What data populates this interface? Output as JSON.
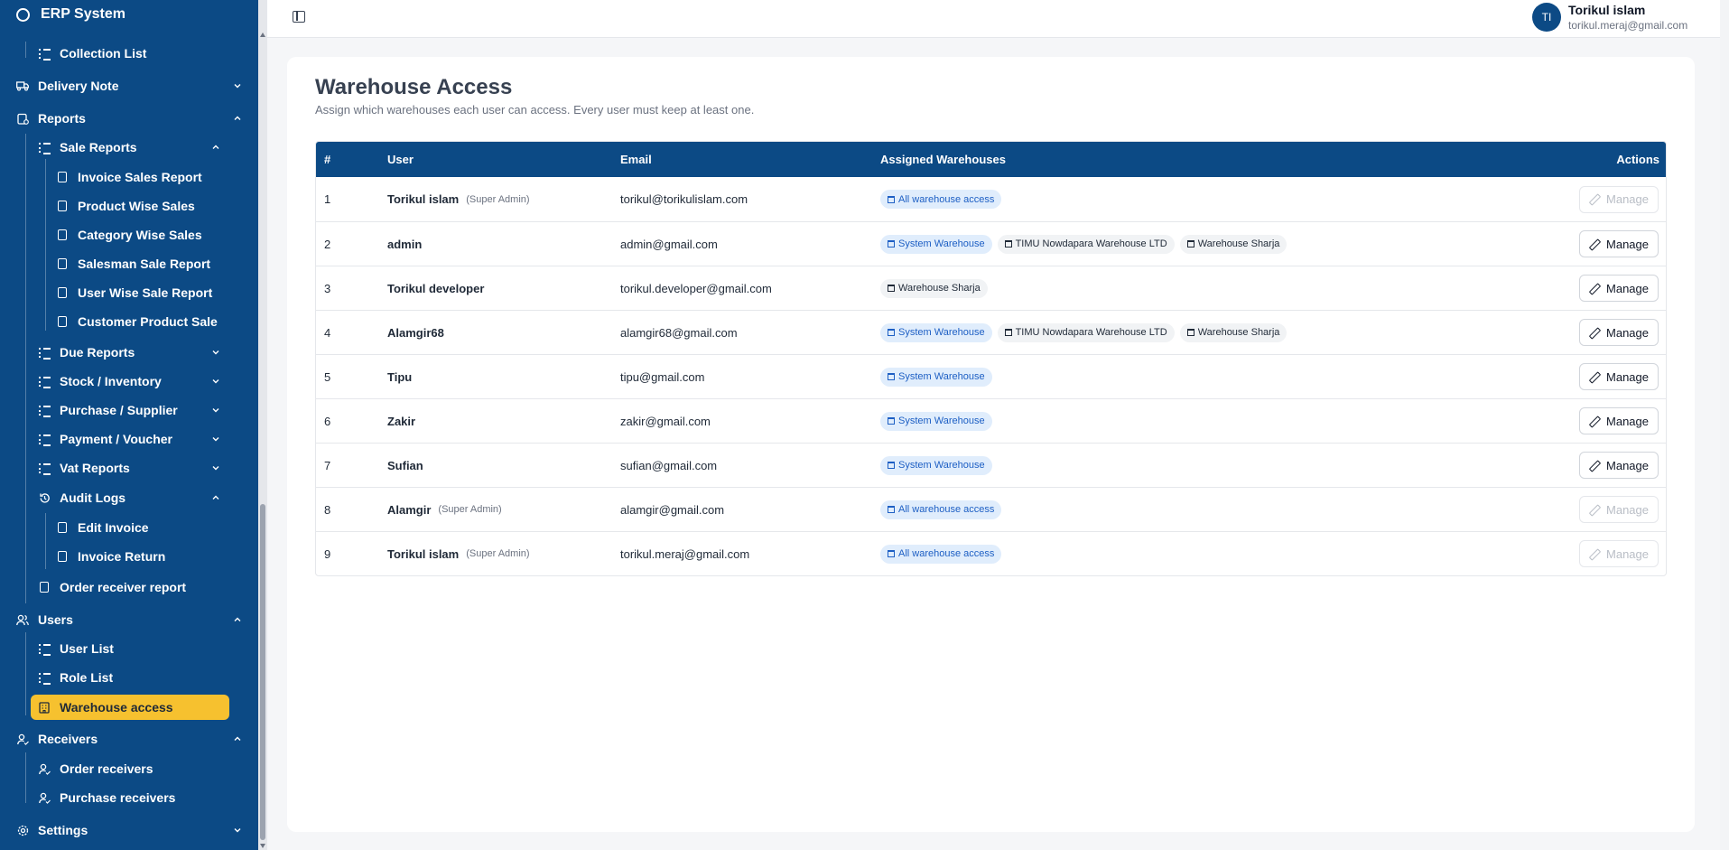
{
  "app": {
    "title": "ERP System"
  },
  "header": {
    "user_name": "Torikul islam",
    "user_email": "torikul.meraj@gmail.com",
    "avatar_initials": "TI"
  },
  "sidebar": {
    "collection_list": "Collection List",
    "delivery_note": "Delivery Note",
    "reports": "Reports",
    "sale_reports": "Sale Reports",
    "sale_items": [
      "Invoice Sales Report",
      "Product Wise Sales",
      "Category Wise Sales",
      "Salesman Sale Report",
      "User Wise Sale Report",
      "Customer Product Sale"
    ],
    "due_reports": "Due Reports",
    "stock_inventory": "Stock / Inventory",
    "purchase_supplier": "Purchase / Supplier",
    "payment_voucher": "Payment / Voucher",
    "vat_reports": "Vat Reports",
    "audit_logs": "Audit Logs",
    "audit_items": [
      "Edit Invoice",
      "Invoice Return"
    ],
    "order_receiver_report": "Order receiver report",
    "users": "Users",
    "user_list": "User List",
    "role_list": "Role List",
    "warehouse_access": "Warehouse access",
    "receivers": "Receivers",
    "order_receivers": "Order receivers",
    "purchase_receivers": "Purchase receivers",
    "settings": "Settings"
  },
  "page": {
    "title": "Warehouse Access",
    "subtitle": "Assign which warehouses each user can access. Every user must keep at least one."
  },
  "table": {
    "headers": {
      "num": "#",
      "user": "User",
      "email": "Email",
      "warehouses": "Assigned Warehouses",
      "actions": "Actions"
    },
    "manage_label": "Manage",
    "rows": [
      {
        "num": "1",
        "name": "Torikul islam",
        "role": "(Super Admin)",
        "email": "torikul@torikulislam.com",
        "chips": [
          {
            "label": "All warehouse access",
            "color": "blue"
          }
        ],
        "disabled": true
      },
      {
        "num": "2",
        "name": "admin",
        "role": "",
        "email": "admin@gmail.com",
        "chips": [
          {
            "label": "System Warehouse",
            "color": "blue"
          },
          {
            "label": "TIMU Nowdapara Warehouse LTD",
            "color": "gray"
          },
          {
            "label": "Warehouse Sharja",
            "color": "gray"
          }
        ],
        "disabled": false
      },
      {
        "num": "3",
        "name": "Torikul developer",
        "role": "",
        "email": "torikul.developer@gmail.com",
        "chips": [
          {
            "label": "Warehouse Sharja",
            "color": "gray"
          }
        ],
        "disabled": false
      },
      {
        "num": "4",
        "name": "Alamgir68",
        "role": "",
        "email": "alamgir68@gmail.com",
        "chips": [
          {
            "label": "System Warehouse",
            "color": "blue"
          },
          {
            "label": "TIMU Nowdapara Warehouse LTD",
            "color": "gray"
          },
          {
            "label": "Warehouse Sharja",
            "color": "gray"
          }
        ],
        "disabled": false
      },
      {
        "num": "5",
        "name": "Tipu",
        "role": "",
        "email": "tipu@gmail.com",
        "chips": [
          {
            "label": "System Warehouse",
            "color": "blue"
          }
        ],
        "disabled": false
      },
      {
        "num": "6",
        "name": "Zakir",
        "role": "",
        "email": "zakir@gmail.com",
        "chips": [
          {
            "label": "System Warehouse",
            "color": "blue"
          }
        ],
        "disabled": false
      },
      {
        "num": "7",
        "name": "Sufian",
        "role": "",
        "email": "sufian@gmail.com",
        "chips": [
          {
            "label": "System Warehouse",
            "color": "blue"
          }
        ],
        "disabled": false
      },
      {
        "num": "8",
        "name": "Alamgir",
        "role": "(Super Admin)",
        "email": "alamgir@gmail.com",
        "chips": [
          {
            "label": "All warehouse access",
            "color": "blue"
          }
        ],
        "disabled": true
      },
      {
        "num": "9",
        "name": "Torikul islam",
        "role": "(Super Admin)",
        "email": "torikul.meraj@gmail.com",
        "chips": [
          {
            "label": "All warehouse access",
            "color": "blue"
          }
        ],
        "disabled": true
      }
    ]
  },
  "colors": {
    "sidebar_bg": "#0c4a85",
    "active_bg": "#f6c12f",
    "chip_blue": "#1d5fc4"
  }
}
